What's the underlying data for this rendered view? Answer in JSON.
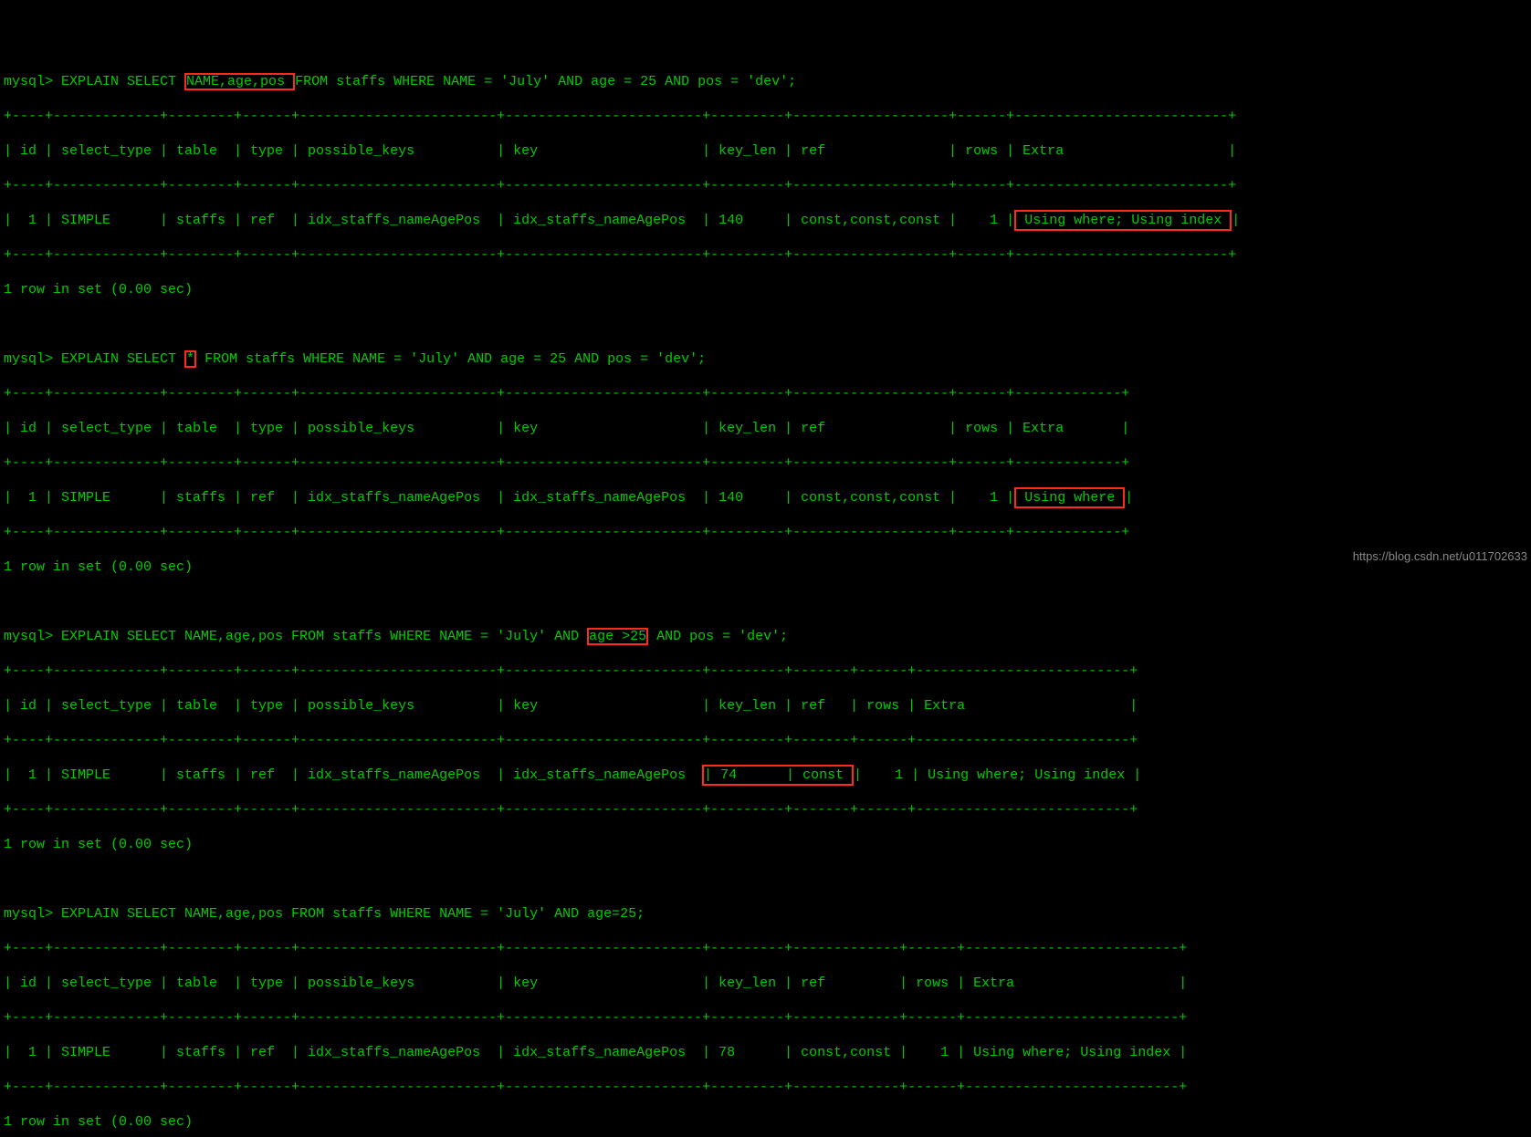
{
  "prompt": "mysql>",
  "row_in_set": "1 row in set (0.00 sec)",
  "q1": {
    "cmd_pre": " EXPLAIN SELECT ",
    "cmd_hl": "NAME,age,pos ",
    "cmd_post": "FROM staffs WHERE NAME = 'July' AND age = 25 AND pos = 'dev';",
    "sep": "+----+-------------+--------+------+------------------------+------------------------+---------+-------------------+------+--------------------------+",
    "hdr": "| id | select_type | table  | type | possible_keys          | key                    | key_len | ref               | rows | Extra                    |",
    "row_pre": "|  1 | SIMPLE      | staffs | ref  | idx_staffs_nameAgePos  | idx_staffs_nameAgePos  | 140     | const,const,const |    1 |",
    "row_hl": " Using where; Using index ",
    "row_post": "|"
  },
  "q2": {
    "cmd_pre": " EXPLAIN SELECT ",
    "cmd_hl": "*",
    "cmd_post": " FROM staffs WHERE NAME = 'July' AND age = 25 AND pos = 'dev';",
    "sep": "+----+-------------+--------+------+------------------------+------------------------+---------+-------------------+------+-------------+",
    "hdr": "| id | select_type | table  | type | possible_keys          | key                    | key_len | ref               | rows | Extra       |",
    "row_pre": "|  1 | SIMPLE      | staffs | ref  | idx_staffs_nameAgePos  | idx_staffs_nameAgePos  | 140     | const,const,const |    1 |",
    "row_hl": " Using where ",
    "row_post": "|"
  },
  "q3": {
    "cmd_pre": " EXPLAIN SELECT NAME,age,pos FROM staffs WHERE NAME = 'July' AND ",
    "cmd_hl": "age >25",
    "cmd_post": " AND pos = 'dev';",
    "sep": "+----+-------------+--------+------+------------------------+------------------------+---------+-------+------+--------------------------+",
    "hdr": "| id | select_type | table  | type | possible_keys          | key                    | key_len | ref   | rows | Extra                    |",
    "row_pre": "|  1 | SIMPLE      | staffs | ref  | idx_staffs_nameAgePos  | idx_staffs_nameAgePos  ",
    "row_hl": "| 74      | const ",
    "row_post": "|    1 | Using where; Using index |"
  },
  "q4": {
    "cmd": " EXPLAIN SELECT NAME,age,pos FROM staffs WHERE NAME = 'July' AND age=25;",
    "sep": "+----+-------------+--------+------+------------------------+------------------------+---------+-------------+------+--------------------------+",
    "hdr": "| id | select_type | table  | type | possible_keys          | key                    | key_len | ref         | rows | Extra                    |",
    "row": "|  1 | SIMPLE      | staffs | ref  | idx_staffs_nameAgePos  | idx_staffs_nameAgePos  | 78      | const,const |    1 | Using where; Using index |"
  },
  "watermark": "https://blog.csdn.net/u011702633"
}
